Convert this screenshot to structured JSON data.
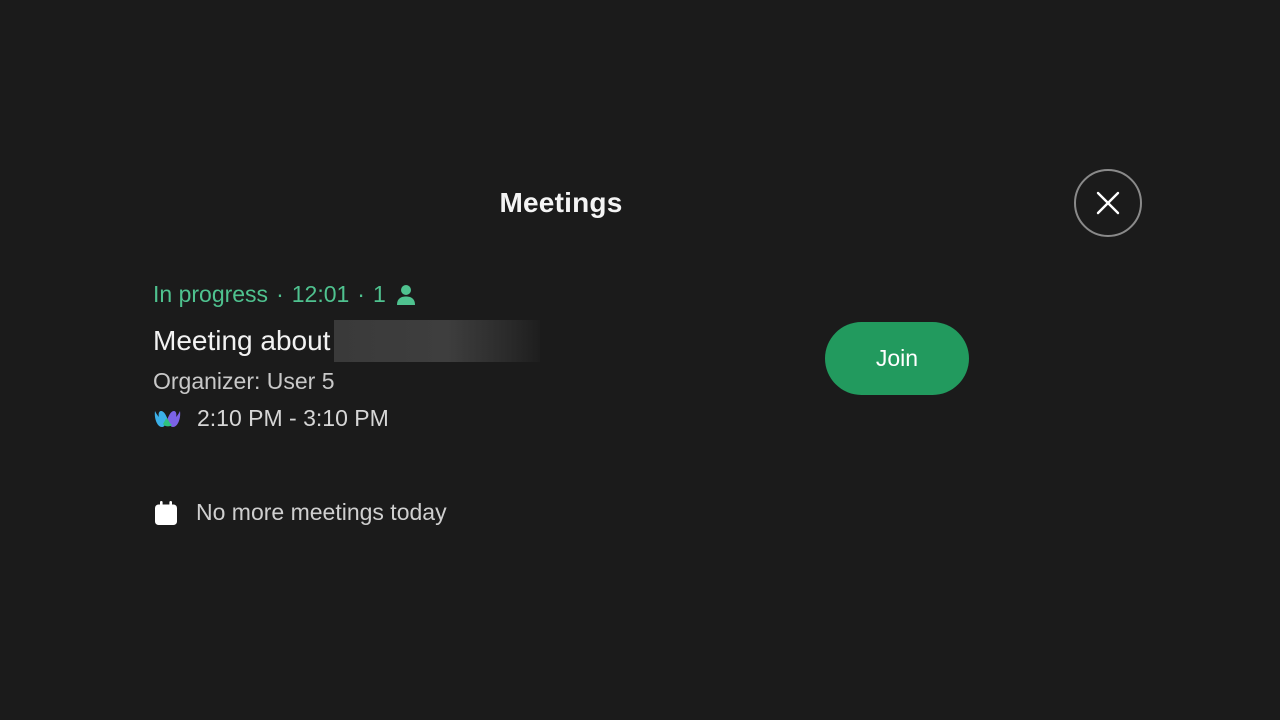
{
  "header": {
    "title": "Meetings",
    "close_icon": "close-icon"
  },
  "meeting": {
    "status": "In progress",
    "separator": "·",
    "elapsed": "12:01",
    "participants": "1",
    "participants_icon": "person-icon",
    "title": "Meeting about",
    "organizer": "Organizer: User 5",
    "time_range": "2:10 PM - 3:10 PM",
    "provider_icon": "webex-icon",
    "join_label": "Join"
  },
  "footer": {
    "no_more_text": "No more meetings today",
    "calendar_icon": "calendar-icon"
  },
  "colors": {
    "background": "#1b1b1b",
    "accent_green": "#4fc28f",
    "join_button": "#229a5e",
    "close_border": "#8a8a8a"
  }
}
